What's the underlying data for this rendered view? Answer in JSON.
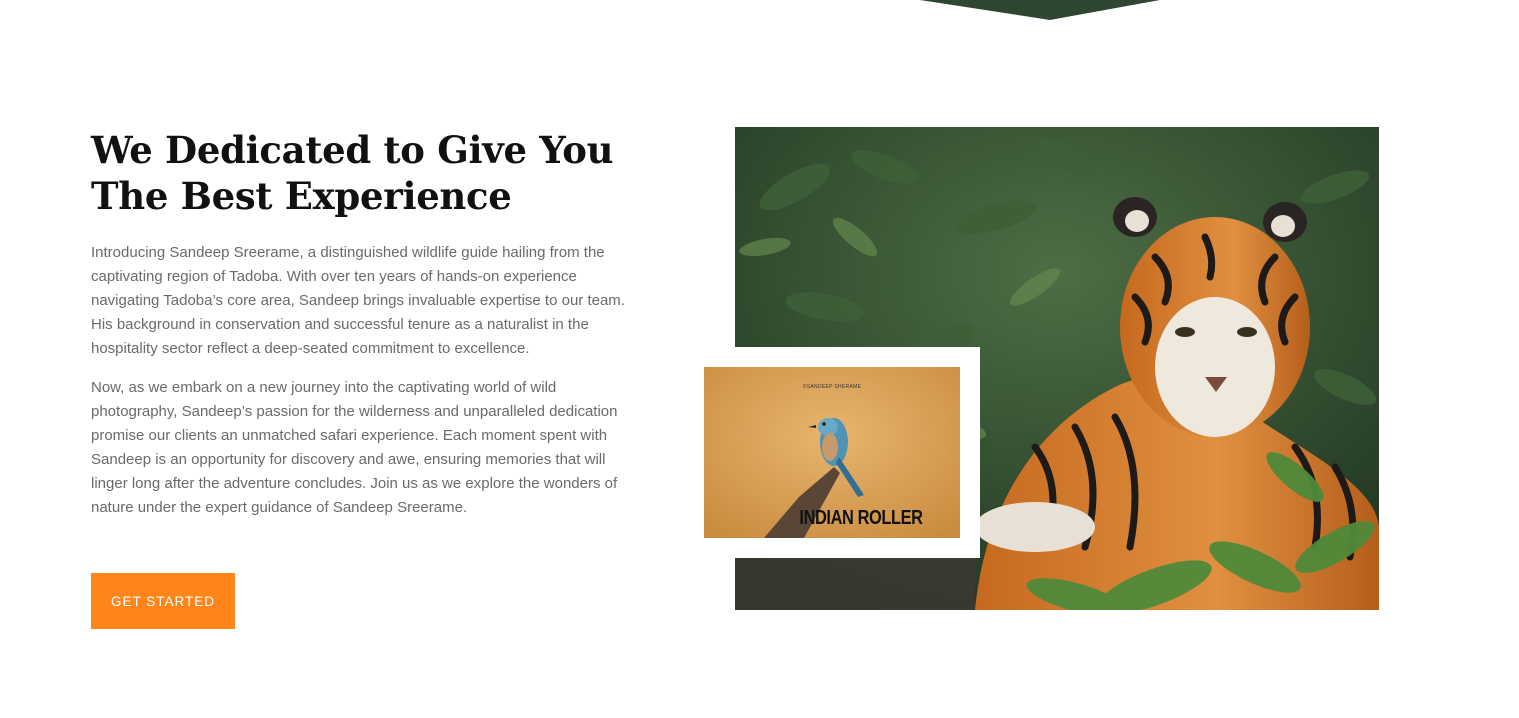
{
  "section": {
    "heading_line1": "We Dedicated to Give You",
    "heading_line2": "The Best Experience",
    "paragraph1": "Introducing Sandeep Sreerame, a distinguished wildlife guide hailing from the captivating region of Tadoba. With over ten years of hands-on experience navigating Tadoba’s core area, Sandeep brings invaluable expertise to our team. His background in conservation and successful tenure as a naturalist in the hospitality sector reflect a deep-seated commitment to excellence.",
    "paragraph2": "Now, as we embark on a new journey into the captivating world of wild photography, Sandeep’s passion for the wilderness and unparalleled dedication promise our clients an unmatched safari experience. Each moment spent with Sandeep is an opportunity for discovery and awe, ensuring memories that will linger long after the adventure concludes. Join us as we explore the wonders of nature under the expert guidance of Sandeep Sreerame.",
    "cta_label": "GET STARTED"
  },
  "inset": {
    "credit": "©SANDEEP SHERAME",
    "caption": "INDIAN ROLLER"
  },
  "colors": {
    "accent": "#ff851b",
    "heading": "#111111",
    "body_text": "#6a6a6a"
  }
}
